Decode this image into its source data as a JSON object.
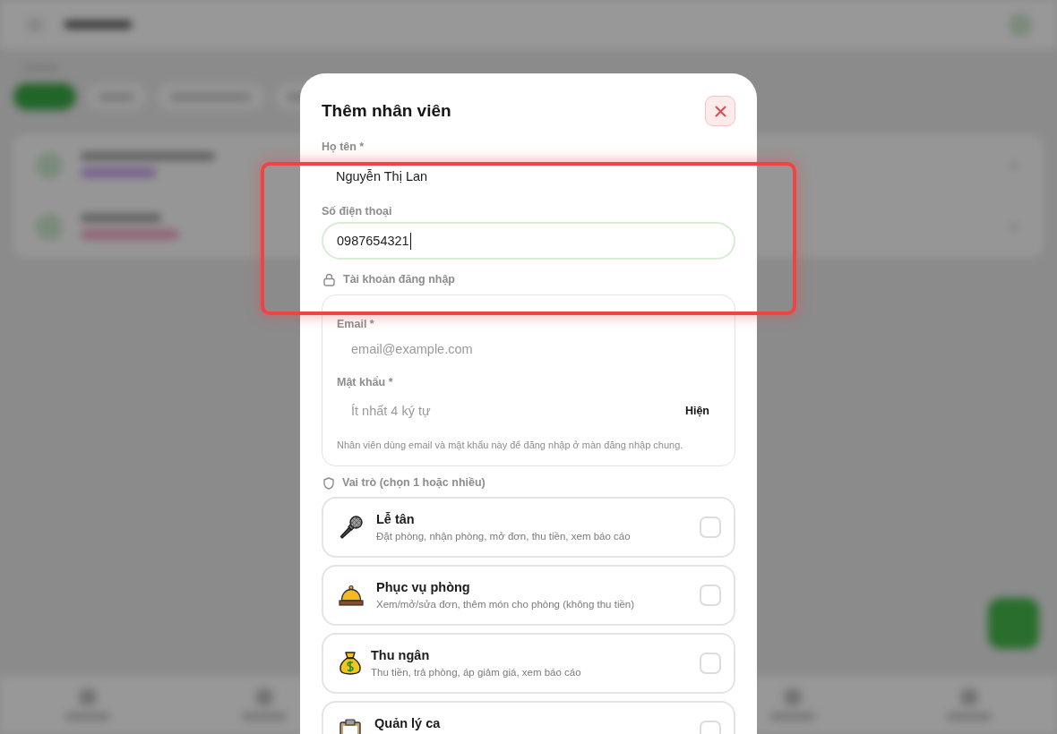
{
  "dialog": {
    "title": "Thêm nhân viên"
  },
  "name_field": {
    "label": "Họ tên *",
    "value": "Nguyễn Thị Lan"
  },
  "phone_field": {
    "label": "Số điện thoại",
    "value": "0987654321",
    "focused": true
  },
  "login_account": {
    "title": "Tài khoản đăng nhập",
    "email_field": {
      "label": "Email *",
      "placeholder": "email@example.com"
    },
    "password_field": {
      "label": "Mật khẩu *",
      "placeholder": "Ít nhất 4 ký tự",
      "toggle_label": "Hiện"
    },
    "hint": "Nhân viên dùng email và mật khẩu này để đăng nhập ở màn đăng nhập chung."
  },
  "roles": {
    "title": "Vai trò (chọn 1 hoặc nhiều)",
    "items": [
      {
        "title": "Lễ tân",
        "description": "Đặt phòng, nhận phòng, mở đơn, thu tiền, xem báo cáo",
        "checked": false
      },
      {
        "title": "Phục vụ phòng",
        "description": "Xem/mở/sửa đơn, thêm món cho phòng (không thu tiền)",
        "checked": false
      },
      {
        "title": "Thu ngân",
        "description": "Thu tiền, trả phòng, áp giảm giá, xem báo cáo",
        "checked": false
      },
      {
        "title": "Quản lý ca",
        "checked": false
      }
    ]
  }
}
